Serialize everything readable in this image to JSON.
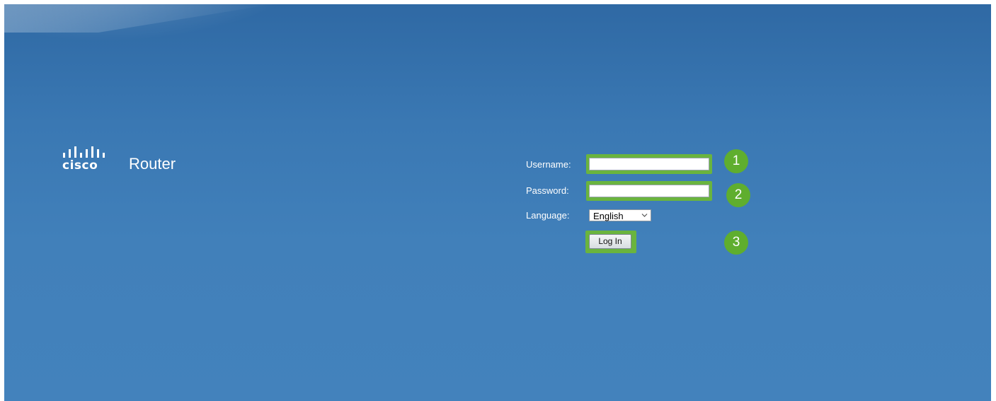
{
  "brand": {
    "logo_text": "cisco",
    "app_title": "Router"
  },
  "login_form": {
    "username_label": "Username:",
    "username_value": "",
    "password_label": "Password:",
    "password_value": "",
    "language_label": "Language:",
    "language_selected": "English",
    "login_button_label": "Log In"
  },
  "annotations": {
    "step_1": "1",
    "step_2": "2",
    "step_3": "3",
    "highlight_color": "#6ab43e",
    "badge_color": "#5fae2e"
  },
  "colors": {
    "background": "#3b79b4"
  },
  "icons": {
    "logo": "cisco-logo-icon",
    "select_arrow": "chevron-down-icon"
  }
}
